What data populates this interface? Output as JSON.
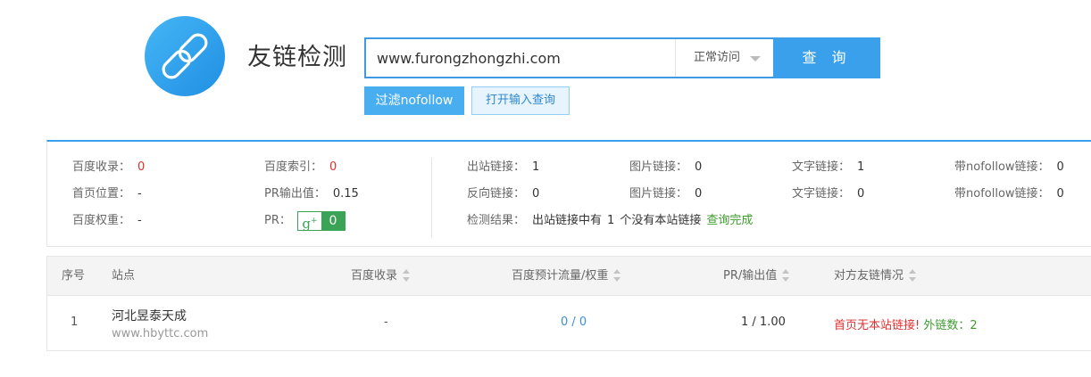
{
  "header": {
    "logo_icon": "chain-link-icon",
    "title": "友链检测"
  },
  "search": {
    "value": "www.furongzhongzhi.com",
    "mode": "正常访问",
    "query_label": "查 询"
  },
  "actions": {
    "nofollow_label": "过滤nofollow",
    "open_input_label": "打开输入查询"
  },
  "stats": {
    "baidu_indexed": {
      "label": "百度收录：",
      "value": "0"
    },
    "baidu_index": {
      "label": "百度索引：",
      "value": "0"
    },
    "home_position": {
      "label": "首页位置：",
      "value": "-"
    },
    "pr_output": {
      "label": "PR输出值：",
      "value": "0.15"
    },
    "baidu_weight": {
      "label": "百度权重：",
      "value": "-"
    },
    "pr": {
      "label": "PR：",
      "badge_g": "g",
      "badge_plus": "+",
      "value": "0"
    },
    "outbound_links": {
      "label": "出站链接：",
      "value": "1"
    },
    "outbound_image_links": {
      "label": "图片链接：",
      "value": "0"
    },
    "outbound_text_links": {
      "label": "文字链接：",
      "value": "1"
    },
    "outbound_nofollow": {
      "label": "带nofollow链接：",
      "value": "0"
    },
    "backlinks": {
      "label": "反向链接：",
      "value": "0"
    },
    "back_image_links": {
      "label": "图片链接：",
      "value": "0"
    },
    "back_text_links": {
      "label": "文字链接：",
      "value": "0"
    },
    "back_nofollow": {
      "label": "带nofollow链接：",
      "value": "0"
    },
    "result": {
      "label": "检测结果：",
      "text_before": "出站链接中有",
      "count": "1",
      "text_after": "个没有本站链接",
      "status": "查询完成"
    }
  },
  "table": {
    "headers": [
      "序号",
      "站点",
      "百度收录",
      "百度预计流量/权重",
      "PR/输出值",
      "对方友链情况"
    ],
    "rows": [
      {
        "index": "1",
        "site_name": "河北昱泰天成",
        "site_url": "www.hbyttc.com",
        "baidu_indexed": "-",
        "traffic_weight": "0 / 0",
        "pr_output": "1 / 1.00",
        "link_status": "首页无本站链接!",
        "outbound_label": "外链数：",
        "outbound_count": "2"
      }
    ]
  },
  "colors": {
    "accent": "#3aa0ec",
    "danger": "#e03030",
    "success": "#3f9a2e",
    "link": "#3a8ee6"
  }
}
